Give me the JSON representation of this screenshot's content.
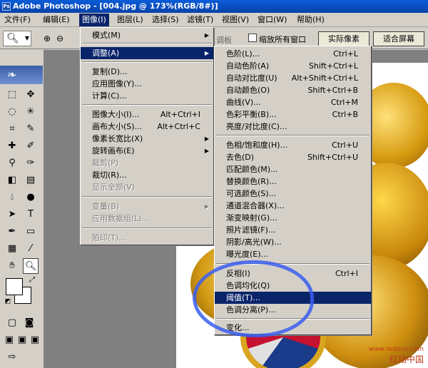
{
  "window": {
    "title": "Adobe Photoshop - [004.jpg @ 173%(RGB/8#)]"
  },
  "menubar": [
    "文件(F)",
    "编辑(E)",
    "图像(I)",
    "图层(L)",
    "选择(S)",
    "滤镜(T)",
    "视图(V)",
    "窗口(W)",
    "帮助(H)"
  ],
  "options": {
    "palette_tab": "调板",
    "checkbox_label": "缩放所有窗口",
    "btn_actual": "实际像素",
    "btn_fit": "适合屏幕"
  },
  "image_menu": [
    {
      "label": "模式(M)",
      "sub": true
    },
    {
      "label": "调整(A)",
      "sub": true,
      "highlight": true
    },
    {
      "label": "复制(D)..."
    },
    {
      "label": "应用图像(Y)..."
    },
    {
      "label": "计算(C)..."
    },
    {
      "label": "图像大小(I)...",
      "shortcut": "Alt+Ctrl+I"
    },
    {
      "label": "画布大小(S)...",
      "shortcut": "Alt+Ctrl+C"
    },
    {
      "label": "像素长宽比(X)",
      "sub": true
    },
    {
      "label": "旋转画布(E)",
      "sub": true
    },
    {
      "label": "裁剪(P)",
      "disabled": true
    },
    {
      "label": "裁切(R)..."
    },
    {
      "label": "显示全部(V)",
      "disabled": true
    },
    {
      "label": "变量(B)",
      "sub": true,
      "disabled": true
    },
    {
      "label": "应用数据组(L)...",
      "disabled": true
    },
    {
      "label": "陷印(T)...",
      "disabled": true
    }
  ],
  "adjust_menu": [
    {
      "label": "色阶(L)...",
      "shortcut": "Ctrl+L"
    },
    {
      "label": "自动色阶(A)",
      "shortcut": "Shift+Ctrl+L"
    },
    {
      "label": "自动对比度(U)",
      "shortcut": "Alt+Shift+Ctrl+L"
    },
    {
      "label": "自动颜色(O)",
      "shortcut": "Shift+Ctrl+B"
    },
    {
      "label": "曲线(V)...",
      "shortcut": "Ctrl+M"
    },
    {
      "label": "色彩平衡(B)...",
      "shortcut": "Ctrl+B"
    },
    {
      "label": "亮度/对比度(C)..."
    },
    {
      "label": "色相/饱和度(H)...",
      "shortcut": "Ctrl+U"
    },
    {
      "label": "去色(D)",
      "shortcut": "Shift+Ctrl+U"
    },
    {
      "label": "匹配颜色(M)..."
    },
    {
      "label": "替换颜色(R)..."
    },
    {
      "label": "可选颜色(S)..."
    },
    {
      "label": "通道混合器(X)..."
    },
    {
      "label": "渐变映射(G)..."
    },
    {
      "label": "照片滤镜(F)..."
    },
    {
      "label": "阴影/高光(W)..."
    },
    {
      "label": "曝光度(E)..."
    },
    {
      "label": "反相(I)",
      "shortcut": "Ctrl+I"
    },
    {
      "label": "色调均化(Q)"
    },
    {
      "label": "阈值(T)...",
      "highlight": true
    },
    {
      "label": "色调分离(P)..."
    },
    {
      "label": "变化..."
    }
  ],
  "watermark": {
    "url": "www.redocn.com",
    "cn": "红动中国"
  },
  "colors": {
    "highlight": "#0a246a",
    "annotation": "#3a5ef0",
    "titlebar": "#0a5cd8"
  }
}
